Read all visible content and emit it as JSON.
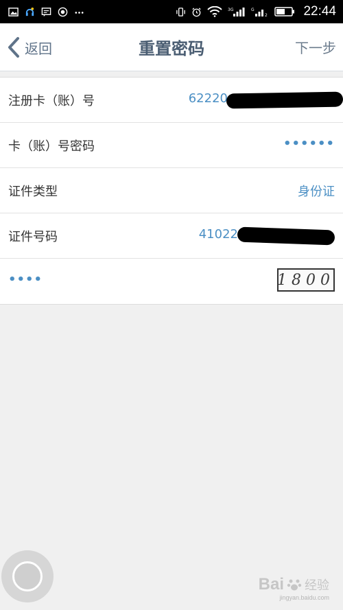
{
  "status_bar": {
    "time": "22:44"
  },
  "nav": {
    "back_label": "返回",
    "title": "重置密码",
    "next_label": "下一步"
  },
  "form": {
    "card_number": {
      "label": "注册卡（账）号",
      "value": "62220"
    },
    "card_password": {
      "label": "卡（账）号密码",
      "value": "••••••"
    },
    "id_type": {
      "label": "证件类型",
      "value": "身份证"
    },
    "id_number": {
      "label": "证件号码",
      "value": "41022"
    },
    "captcha": {
      "input_value": "••••",
      "image_text": "1800"
    }
  },
  "watermark": {
    "brand": "Bai",
    "sub": "经验",
    "url": "jingyan.baidu.com"
  }
}
